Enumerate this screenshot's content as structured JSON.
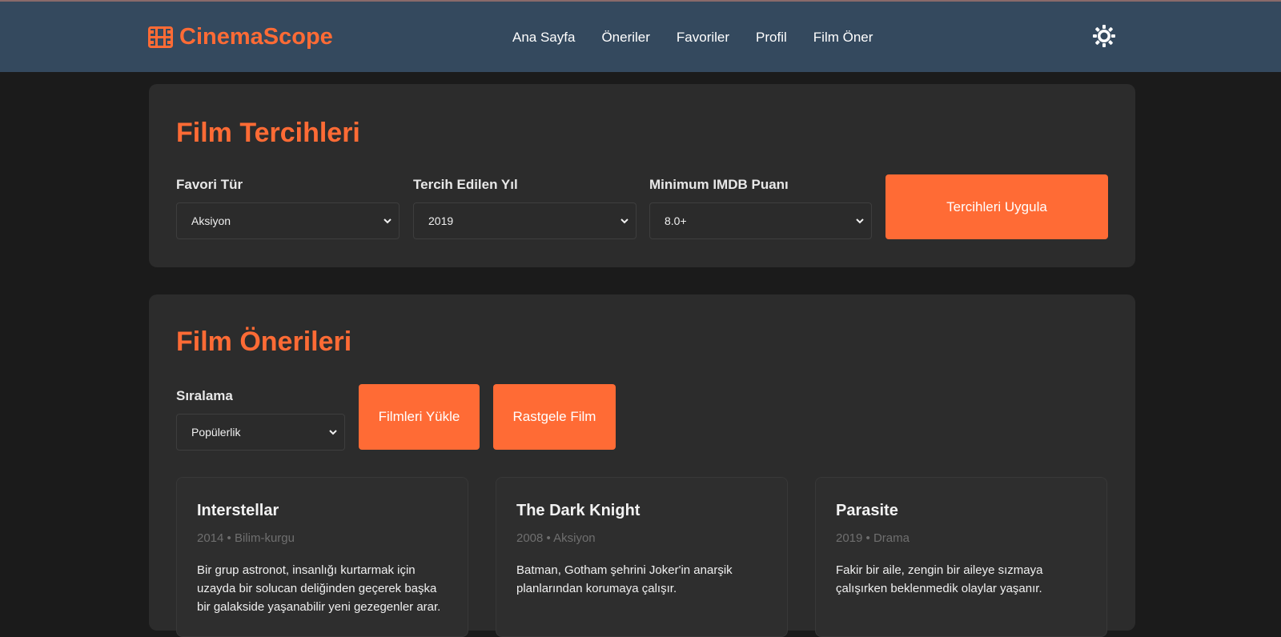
{
  "app": {
    "name": "CinemaScope",
    "brand_color": "#ff6b35",
    "header_color": "#34495e",
    "logo_icon": "film-icon",
    "theme_icon": "sun-icon"
  },
  "nav": {
    "items": [
      {
        "label": "Ana Sayfa"
      },
      {
        "label": "Öneriler"
      },
      {
        "label": "Favoriler"
      },
      {
        "label": "Profil"
      },
      {
        "label": "Film Öner"
      }
    ]
  },
  "preferences": {
    "title": "Film Tercihleri",
    "genre": {
      "label": "Favori Tür",
      "value": "Aksiyon"
    },
    "year": {
      "label": "Tercih Edilen Yıl",
      "value": "2019"
    },
    "rating": {
      "label": "Minimum IMDB Puanı",
      "value": "8.0+"
    },
    "apply_label": "Tercihleri Uygula"
  },
  "recommendations": {
    "title": "Film Önerileri",
    "sort": {
      "label": "Sıralama",
      "value": "Popülerlik"
    },
    "load_label": "Filmleri Yükle",
    "random_label": "Rastgele Film",
    "movies": [
      {
        "title": "Interstellar",
        "meta": "2014 • Bilim-kurgu",
        "description": "Bir grup astronot, insanlığı kurtarmak için uzayda bir solucan deliğinden geçerek başka bir galakside yaşanabilir yeni gezegenler arar."
      },
      {
        "title": "The Dark Knight",
        "meta": "2008 • Aksiyon",
        "description": "Batman, Gotham şehrini Joker'in anarşik planlarından korumaya çalışır."
      },
      {
        "title": "Parasite",
        "meta": "2019 • Drama",
        "description": "Fakir bir aile, zengin bir aileye sızmaya çalışırken beklenmedik olaylar yaşanır."
      }
    ]
  }
}
